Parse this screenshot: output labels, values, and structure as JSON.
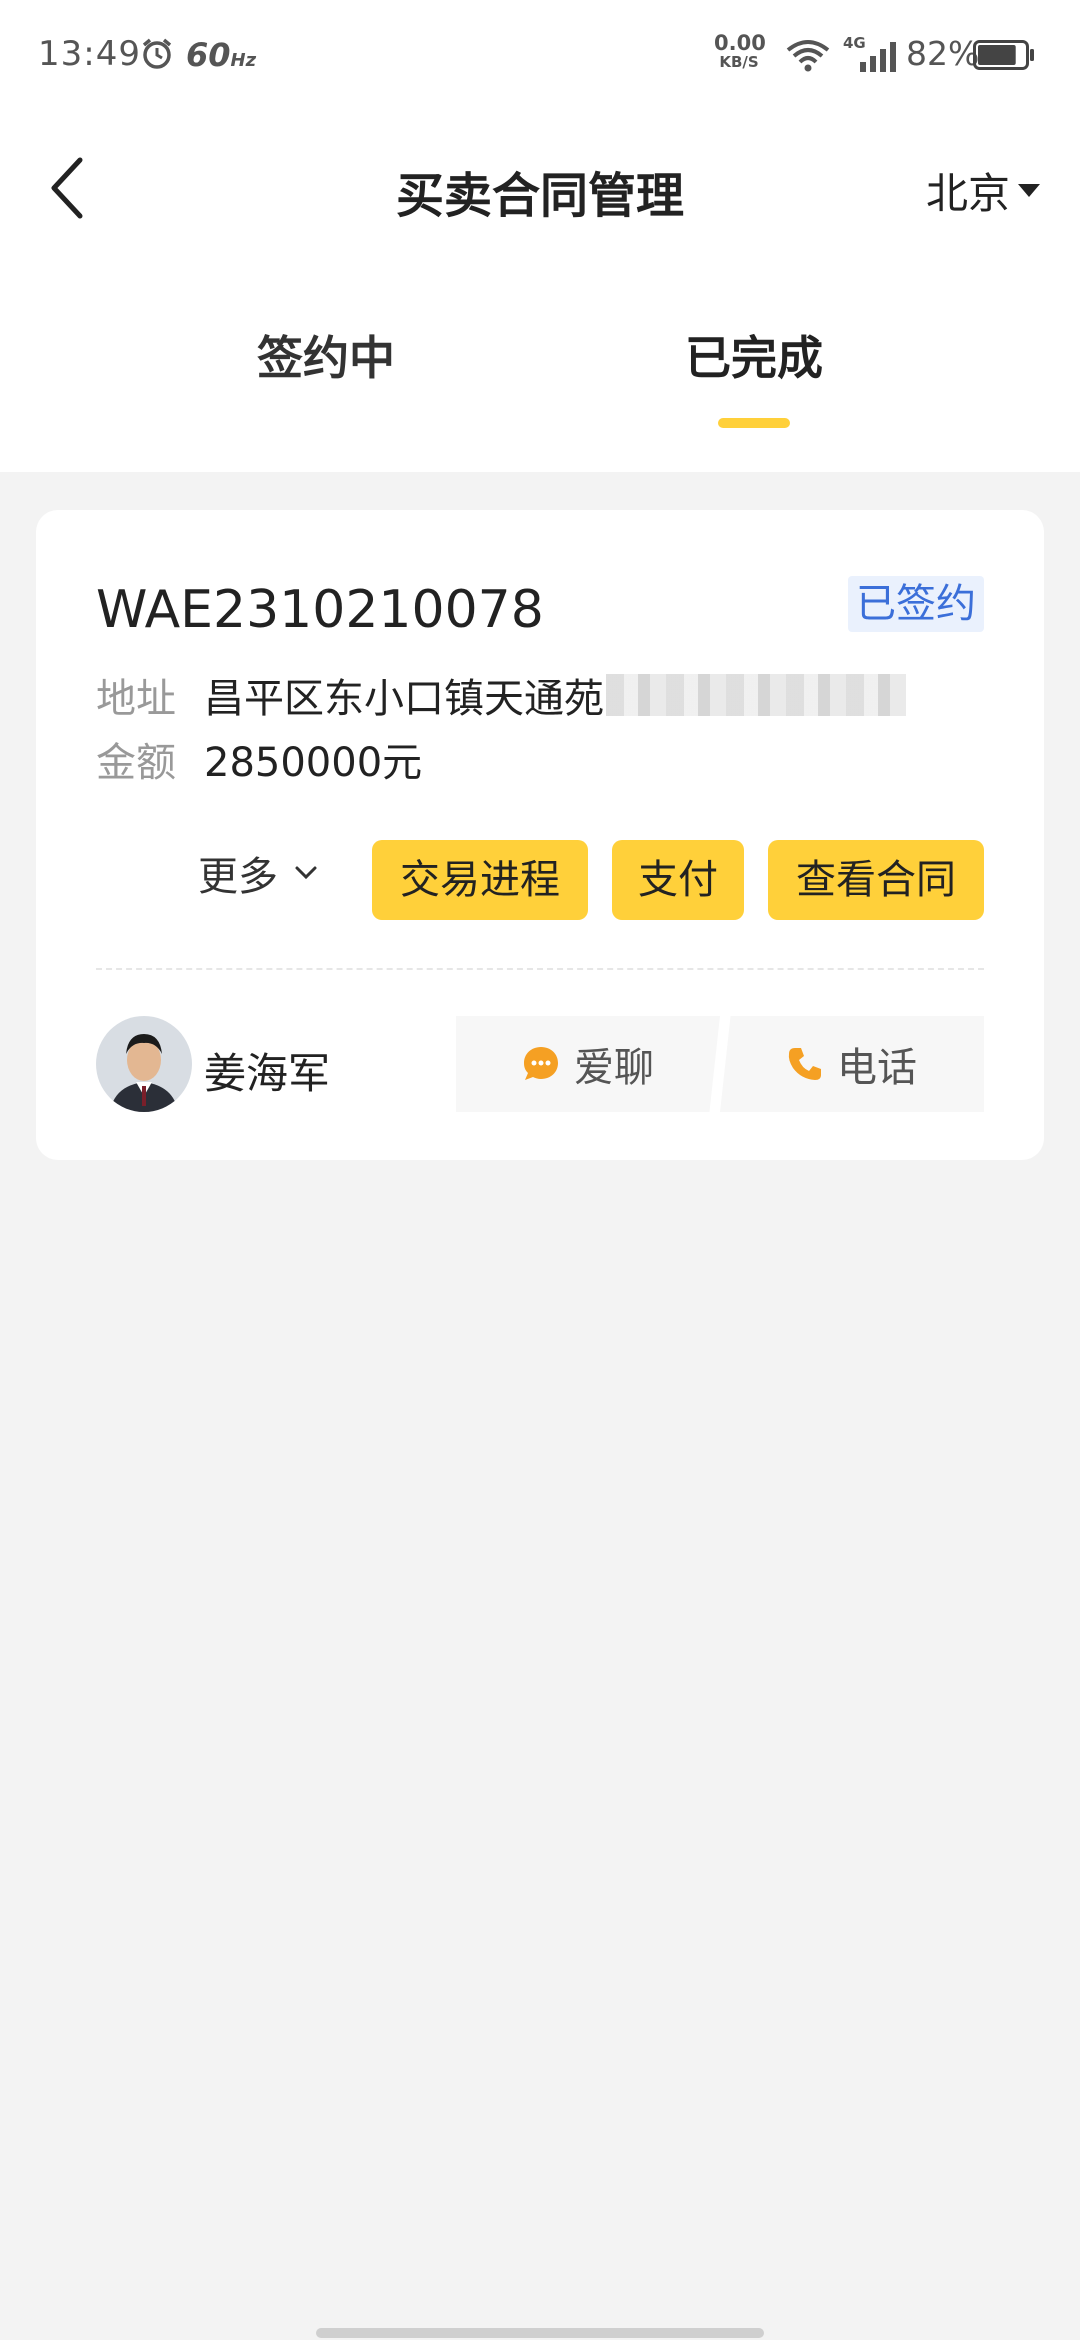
{
  "status_bar": {
    "time": "13:49",
    "refresh_rate": "60",
    "refresh_unit": "Hz",
    "net_speed_value": "0.00",
    "net_speed_unit": "KB/S",
    "network_type": "4G",
    "battery_percent": "82%",
    "battery_level": 0.82
  },
  "header": {
    "title": "买卖合同管理",
    "city": "北京"
  },
  "tabs": [
    {
      "label": "签约中",
      "active": false
    },
    {
      "label": "已完成",
      "active": true
    }
  ],
  "contract": {
    "number": "WAE2310210078",
    "status": "已签约",
    "address_label": "地址",
    "address_value": "昌平区东小口镇天通苑",
    "amount_label": "金额",
    "amount_value": "2850000元",
    "more_label": "更多",
    "buttons": {
      "progress": "交易进程",
      "pay": "支付",
      "view_contract": "查看合同"
    },
    "agent": {
      "name": "姜海军",
      "chat_label": "爱聊",
      "phone_label": "电话"
    }
  },
  "colors": {
    "accent_yellow": "#ffd03a",
    "status_blue": "#3b6fd9",
    "icon_orange": "#f5a023"
  }
}
